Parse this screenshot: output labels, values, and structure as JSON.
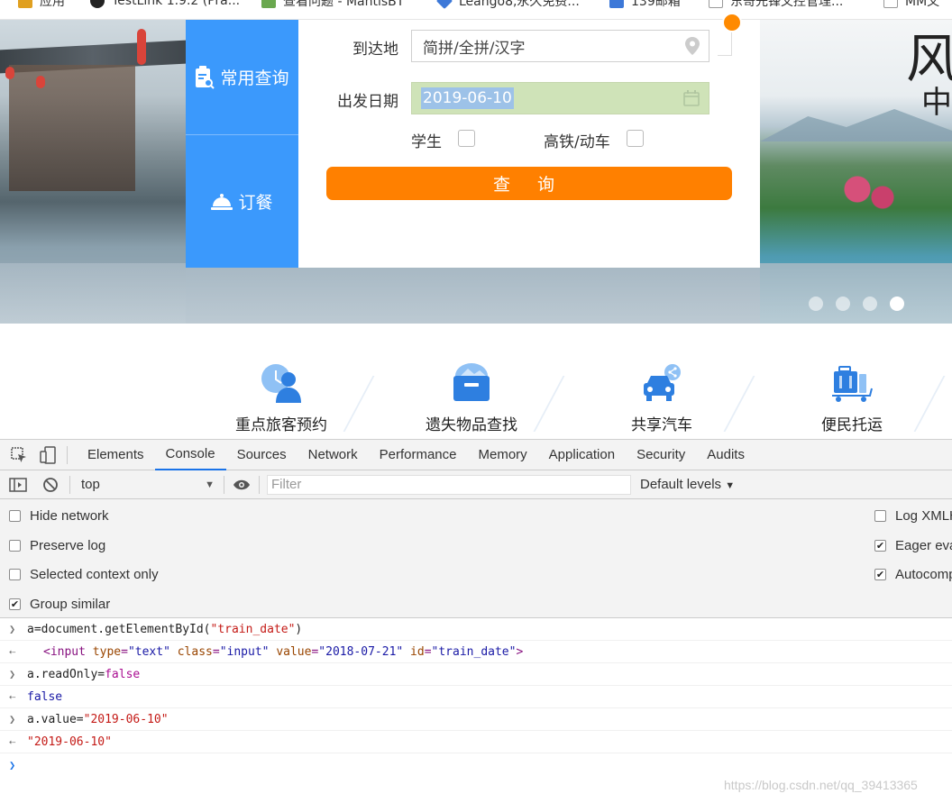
{
  "bookmarks": [
    {
      "label": "应用",
      "color": "#e0a020"
    },
    {
      "label": "TestLink 1.9.2 (Pra...",
      "color": "#222222"
    },
    {
      "label": "查看问题 - MantisBT",
      "color": "#6aa84f"
    },
    {
      "label": "Leango8,永久免费...",
      "color": "#3c78d8"
    },
    {
      "label": "139邮箱",
      "color": "#3c78d8"
    },
    {
      "label": "东哥先锋文控管理...",
      "color": "#999999"
    },
    {
      "label": "MM文",
      "color": "#999999"
    }
  ],
  "side_nav": {
    "item1": "常用查询",
    "item2": "订餐"
  },
  "form": {
    "dest_label": "到达地",
    "dest_placeholder": "简拼/全拼/汉字",
    "date_label": "出发日期",
    "date_value": "2019-06-10",
    "student_label": "学生",
    "highspeed_label": "高铁/动车",
    "search_label": "查 询"
  },
  "banner": {
    "char1": "风",
    "char2": "中",
    "slides_total": 4,
    "active_slide": 4
  },
  "services": [
    {
      "label": "重点旅客预约",
      "icon": "passenger-icon"
    },
    {
      "label": "遗失物品查找",
      "icon": "lost-item-icon"
    },
    {
      "label": "共享汽车",
      "icon": "car-share-icon"
    },
    {
      "label": "便民托运",
      "icon": "luggage-cart-icon"
    }
  ],
  "devtools": {
    "tabs": [
      "Elements",
      "Console",
      "Sources",
      "Network",
      "Performance",
      "Memory",
      "Application",
      "Security",
      "Audits"
    ],
    "active_tab": "Console",
    "context": "top",
    "filter_placeholder": "Filter",
    "levels": "Default levels",
    "settings": {
      "hide_network": "Hide network",
      "preserve_log": "Preserve log",
      "selected_context": "Selected context only",
      "group_similar": "Group similar",
      "log_xhr": "Log XMLH",
      "eager_eval": "Eager eva",
      "autocomplete": "Autocomp"
    },
    "console_lines": {
      "l1_var": "a",
      "l1_rest": "=document.getElementById(",
      "l1_arg": "\"train_date\"",
      "l1_close": ")",
      "l2_open": "<input",
      "l2_type_attr": "type",
      "l2_type_val": "\"text\"",
      "l2_class_attr": "class",
      "l2_class_val": "\"input\"",
      "l2_value_attr": "value",
      "l2_value_val": "\"2018-07-21\"",
      "l2_id_attr": "id",
      "l2_id_val": "\"train_date\"",
      "l2_close": ">",
      "l3_expr": "a.readOnly=",
      "l3_val": "false",
      "l4_out": "false",
      "l5_expr": "a.value=",
      "l5_val": "\"2019-06-10\"",
      "l6_out": "\"2019-06-10\""
    }
  },
  "watermark": "https://blog.csdn.net/qq_39413365"
}
